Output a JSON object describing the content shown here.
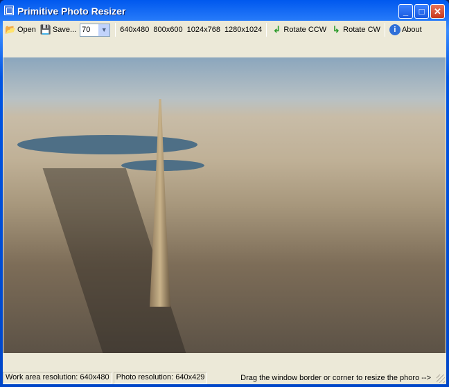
{
  "window": {
    "title": "Primitive Photo Resizer"
  },
  "toolbar": {
    "open_label": "Open",
    "save_label": "Save...",
    "quality_value": "70",
    "presets": [
      "640x480",
      "800x600",
      "1024x768",
      "1280x1024"
    ],
    "rotate_ccw_label": "Rotate CCW",
    "rotate_cw_label": "Rotate CW",
    "about_label": "About"
  },
  "status": {
    "work_area": "Work area resolution: 640x480",
    "photo_res": "Photo resolution: 640x429",
    "hint": "Drag the window border or corner to resize the phoro -->"
  }
}
